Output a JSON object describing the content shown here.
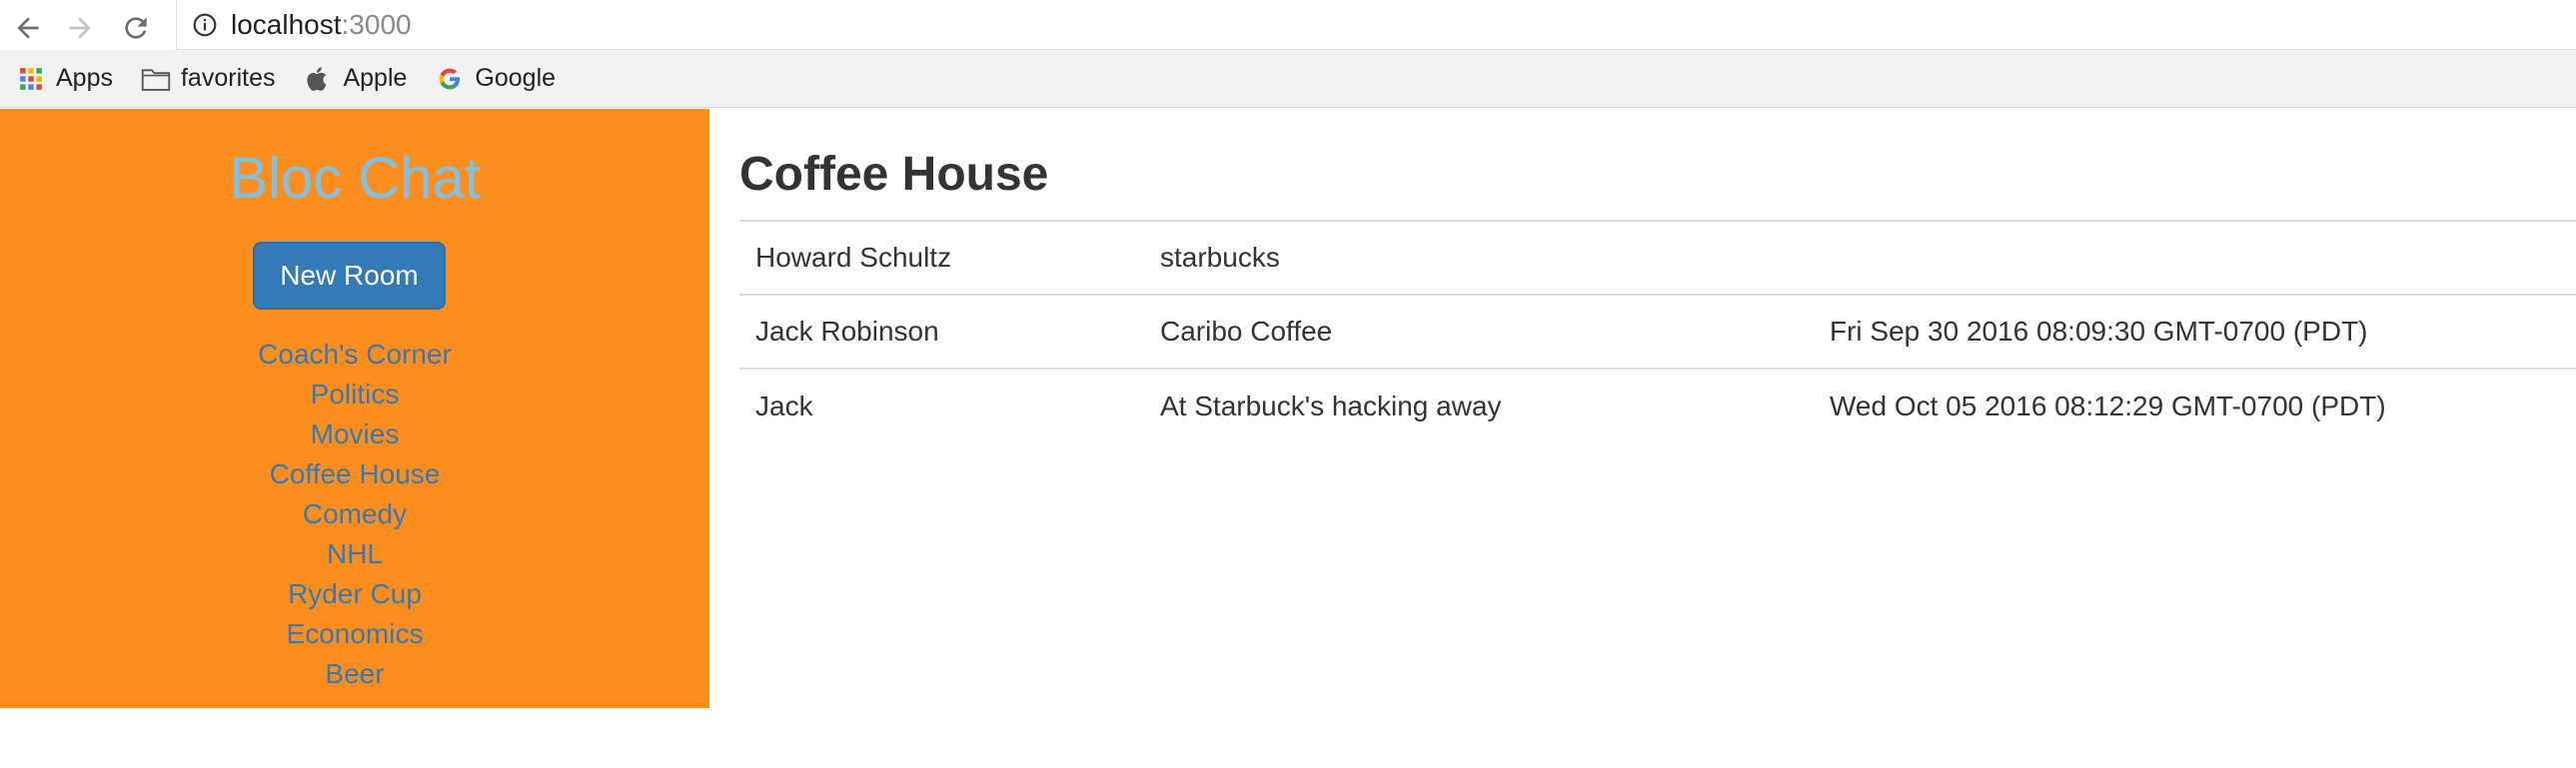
{
  "browser": {
    "url_host": "localhost",
    "url_port": ":3000",
    "bookmarks": [
      {
        "label": "Apps",
        "icon": "apps-grid-icon"
      },
      {
        "label": "favorites",
        "icon": "folder-icon"
      },
      {
        "label": "Apple",
        "icon": "apple-logo-icon"
      },
      {
        "label": "Google",
        "icon": "google-logo-icon"
      }
    ]
  },
  "sidebar": {
    "title": "Bloc Chat",
    "new_room_label": "New Room",
    "rooms": [
      "Coach's Corner",
      "Politics",
      "Movies",
      "Coffee House",
      "Comedy",
      "NHL",
      "Ryder Cup",
      "Economics",
      "Beer"
    ]
  },
  "main": {
    "room_title": "Coffee House",
    "messages": [
      {
        "username": "Howard Schultz",
        "content": "starbucks",
        "sent_at": ""
      },
      {
        "username": "Jack Robinson",
        "content": "Caribo Coffee",
        "sent_at": "Fri Sep 30 2016 08:09:30 GMT-0700 (PDT)"
      },
      {
        "username": "Jack",
        "content": "At Starbuck's hacking away",
        "sent_at": "Wed Oct 05 2016 08:12:29 GMT-0700 (PDT)"
      }
    ]
  },
  "colors": {
    "sidebar_bg": "#fd8e1d",
    "title": "#7fc1e4",
    "link": "#337ab7",
    "button": "#337ab7"
  }
}
